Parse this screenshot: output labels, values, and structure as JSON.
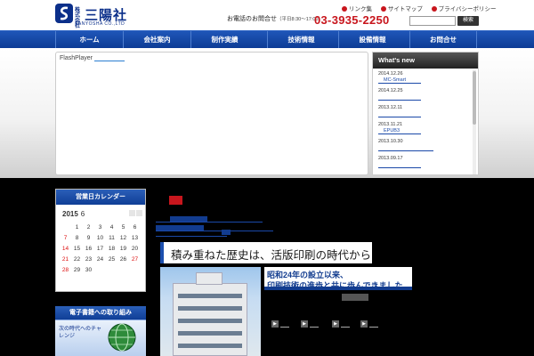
{
  "header": {
    "company_prefix": "株式会社",
    "company_name": "三陽社",
    "company_romaji": "SANYOSHA CO.,LTD",
    "links": [
      "リンク集",
      "サイトマップ",
      "プライバシーポリシー"
    ],
    "contact_label": "お電話のお問合せ",
    "contact_hours": "（平日8:30〜17:00）",
    "phone": "03-3935-2250",
    "search_placeholder": "",
    "search_button": "検索"
  },
  "nav": {
    "items": [
      "ホーム",
      "会社案内",
      "制作実績",
      "技術情報",
      "設備情報",
      "お問合せ"
    ]
  },
  "flash": {
    "label": "FlashPlayer"
  },
  "whats_new": {
    "title": "What's new",
    "items": [
      {
        "date": "2014.12.26",
        "link": "MC-Smart"
      },
      {
        "date": "2014.12.25",
        "link": ""
      },
      {
        "date": "2013.12.11",
        "link": ""
      },
      {
        "date": "2013.11.21",
        "link": "EPUB3"
      },
      {
        "date": "2013.10.30",
        "link": ""
      },
      {
        "date": "2013.09.17",
        "link": ""
      }
    ]
  },
  "calendar": {
    "title": "営業日カレンダー",
    "year": "2015",
    "month": "6",
    "weeks": [
      [
        "",
        "1",
        "2",
        "3",
        "4",
        "5",
        "6"
      ],
      [
        "7",
        "8",
        "9",
        "10",
        "11",
        "12",
        "13"
      ],
      [
        "14",
        "15",
        "16",
        "17",
        "18",
        "19",
        "20"
      ],
      [
        "21",
        "22",
        "23",
        "24",
        "25",
        "26",
        "27"
      ],
      [
        "28",
        "29",
        "30",
        "",
        "",
        "",
        ""
      ]
    ]
  },
  "ebook": {
    "title": "電子書籍への取り組み",
    "subtitle": "次の時代へのチャレンジ"
  },
  "main": {
    "heading": "積み重ねた歴史は、活版印刷の時代から",
    "tagline_1": "昭和24年の設立以来、",
    "tagline_2": "印刷技術の進歩と共に歩んできました"
  }
}
